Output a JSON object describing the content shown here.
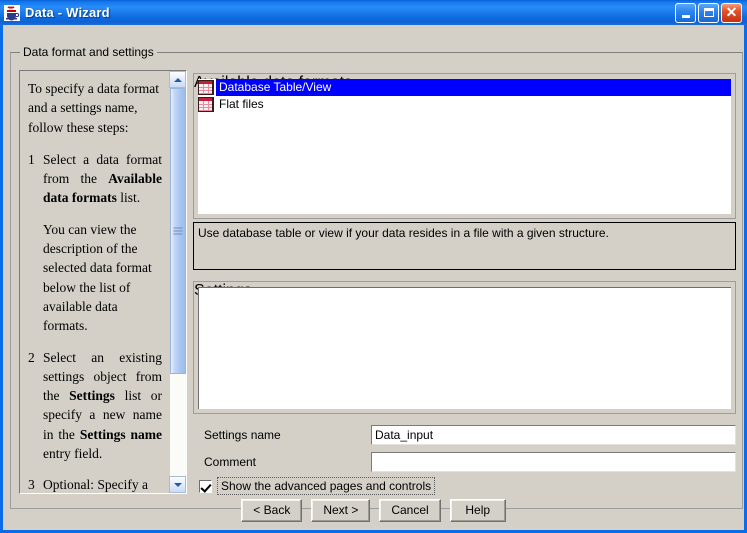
{
  "window": {
    "title": "Data - Wizard",
    "icon": "java-coffee-cup-icon",
    "controls": {
      "minimize": "Minimize",
      "maximize": "Maximize",
      "close": "Close"
    }
  },
  "outer_group": {
    "label": "Data format and settings"
  },
  "instructions": {
    "intro": "To specify a data format and a settings name, follow these steps:",
    "steps": [
      {
        "number": "1",
        "text_before": "Select a data format from the ",
        "bold": "Available data formats",
        "text_after": " list."
      },
      {
        "number": "2",
        "text_before": "Select an existing settings object from the ",
        "bold": "Settings",
        "text_mid": " list or specify a new name in the ",
        "bold2": "Settings name",
        "text_after": " entry field."
      },
      {
        "number": "3",
        "text_before": "Optional: Specify a",
        "bold": "",
        "text_after": ""
      }
    ],
    "note": "You can view the description of the selected data format below the list of available data formats.",
    "scrollbar": {
      "up": "scroll-up",
      "down": "scroll-down"
    }
  },
  "formats_group": {
    "label": "Available data formats",
    "items": [
      {
        "label": "Database Table/View",
        "icon": "table-grid-icon",
        "selected": true
      },
      {
        "label": "Flat files",
        "icon": "table-grid-icon",
        "selected": false
      }
    ]
  },
  "description": {
    "text": "Use database table or view if your data resides in a file with a given structure."
  },
  "settings_group": {
    "label": "Settings",
    "items": []
  },
  "fields": {
    "settings_name": {
      "label": "Settings name",
      "value": "Data_input",
      "placeholder": ""
    },
    "comment": {
      "label": "Comment",
      "value": "",
      "placeholder": ""
    }
  },
  "checkbox": {
    "label": "Show the advanced pages and controls",
    "checked": true
  },
  "buttons": {
    "back": "< Back",
    "next": "Next >",
    "cancel": "Cancel",
    "help": "Help"
  },
  "colors": {
    "titlebar_blue": "#1379ef",
    "selection_blue": "#0000ff",
    "dialog_gray": "#d4d0c8",
    "close_red": "#c8300c"
  }
}
